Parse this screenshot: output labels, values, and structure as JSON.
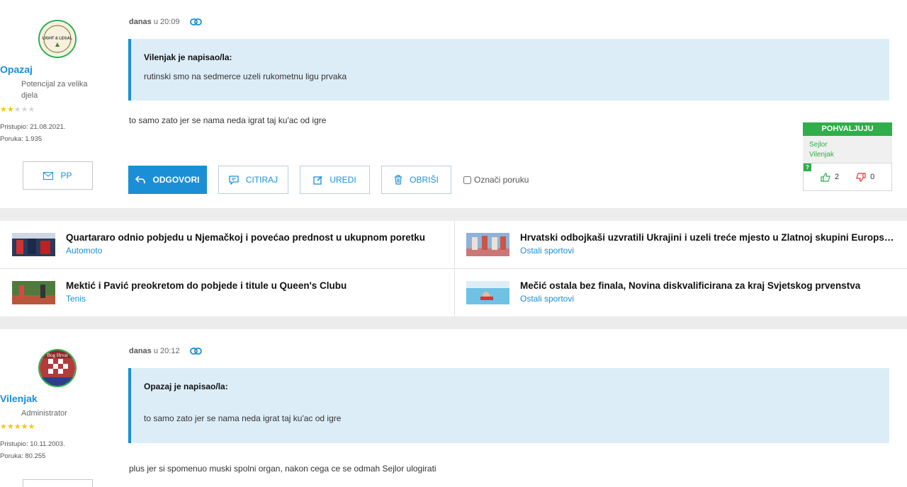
{
  "posts": [
    {
      "author": "Opazaj",
      "avatar_text": "LIGHT & LEGAL",
      "rank": "Potencijal za velika djela",
      "stars_on": 2,
      "stars_total": 5,
      "joined": "Pristupio: 21.08.2021.",
      "post_count": "Poruka: 1.935",
      "pm_label": "PP",
      "time_label": "danas",
      "time": "u 20:09",
      "quote_author": "Vilenjak je napisao/la:",
      "quote_text": "rutinski smo na sedmerce uzeli rukometnu ligu prvaka",
      "text": "to samo zato jer se nama neda igrat taj ku'ac od igre"
    },
    {
      "author": "Vilenjak",
      "avatar_text": "Bog Hrvat",
      "rank": "Administrator",
      "stars_on": 5,
      "stars_total": 5,
      "joined": "Pristupio: 10.11.2003.",
      "post_count": "Poruka: 80.255",
      "time_label": "danas",
      "time": "u 20:12",
      "quote_author": "Opazaj je napisao/la:",
      "quote_text": "to samo zato jer se nama neda igrat taj ku'ac od igre",
      "text": "plus jer si spomenuo muski spolni organ, nakon cega ce se odmah Sejlor ulogirati"
    }
  ],
  "actions": {
    "reply": "ODGOVORI",
    "quote": "CITIRAJ",
    "edit": "UREDI",
    "delete": "OBRIŠI",
    "mark": "Označi poruku"
  },
  "praise": {
    "header": "POHVALJUJU",
    "names": [
      "Sejlor",
      "Vilenjak"
    ],
    "badge": "?",
    "likes": "2",
    "dislikes": "0"
  },
  "related": [
    {
      "title": "Quartararo odnio pobjedu u Njemačkoj i povećao prednost u ukupnom poretku",
      "category": "Automoto"
    },
    {
      "title": "Hrvatski odbojkaši uzvratili Ukrajini i uzeli treće mjesto u Zlatnoj skupini Europske lige",
      "category": "Ostali sportovi"
    },
    {
      "title": "Mektić i Pavić preokretom do pobjede i titule u Queen's Clubu",
      "category": "Tenis"
    },
    {
      "title": "Mečić ostala bez finala, Novina diskvalificirana za kraj Svjetskog prvenstva",
      "category": "Ostali sportovi"
    }
  ],
  "colors": {
    "accent": "#1a8fd6",
    "praise_green": "#2fae4a",
    "quote_bg": "#dcedf8"
  }
}
